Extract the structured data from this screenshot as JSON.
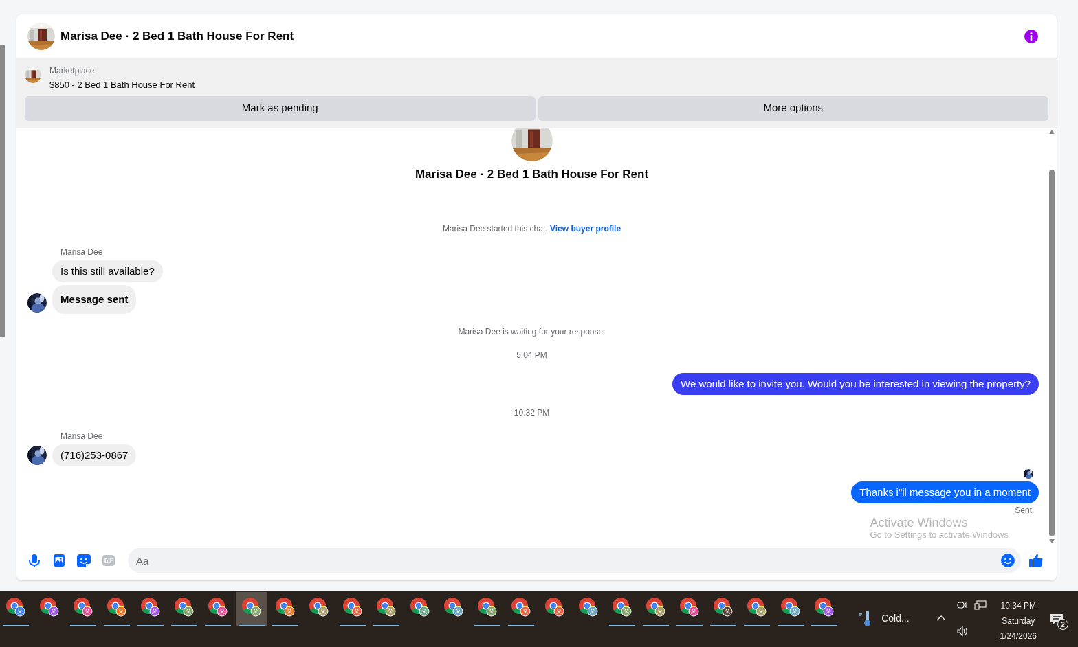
{
  "header": {
    "title": "Marisa Dee · 2 Bed 1 Bath House For Rent"
  },
  "listing": {
    "label": "Marketplace",
    "title": "$850 - 2 Bed 1 Bath House For Rent",
    "buttons": [
      "Mark as pending",
      "More options"
    ]
  },
  "conversation": {
    "title": "Marisa Dee · 2 Bed 1 Bath House For Rent",
    "items": [
      {
        "kind": "system",
        "text": "Marisa Dee started this chat.",
        "link": "View buyer profile"
      },
      {
        "kind": "incoming",
        "sender": "Marisa Dee",
        "messages": [
          {
            "text": "Is this still available?",
            "bold": false
          },
          {
            "text": "Message sent",
            "bold": true
          }
        ]
      },
      {
        "kind": "system",
        "text": "Marisa Dee is waiting for your response."
      },
      {
        "kind": "time",
        "text": "5:04 PM"
      },
      {
        "kind": "outgoing",
        "color": "#3a3ef2",
        "seen": false,
        "messages": [
          {
            "text": "We would like to invite you. Would you be interested in viewing the property?",
            "bold": false
          }
        ]
      },
      {
        "kind": "time",
        "text": "10:32 PM"
      },
      {
        "kind": "incoming",
        "sender": "Marisa Dee",
        "messages": [
          {
            "text": "(716)253-0867",
            "bold": false
          }
        ]
      },
      {
        "kind": "outgoing",
        "color": "#0866ff",
        "seen": true,
        "status": "Sent",
        "messages": [
          {
            "text": "Thanks i\"il message you in a moment",
            "bold": false
          }
        ]
      }
    ]
  },
  "composer": {
    "placeholder": "Aa"
  },
  "watermark": {
    "title": "Activate Windows",
    "subtitle": "Go to Settings to activate Windows"
  },
  "taskbar": {
    "apps": [
      {
        "color": "#3b82f6",
        "running": true,
        "selected": false
      },
      {
        "color": "#a855f7",
        "running": false,
        "selected": false
      },
      {
        "color": "#ec4899",
        "running": true,
        "selected": false
      },
      {
        "color": "#f97316",
        "running": true,
        "selected": false
      },
      {
        "color": "#a855f7",
        "running": true,
        "selected": false
      },
      {
        "color": "#84a86a",
        "running": true,
        "selected": false
      },
      {
        "color": "#ec4899",
        "running": true,
        "selected": false
      },
      {
        "color": "#84a86a",
        "running": true,
        "selected": true
      },
      {
        "color": "#f08030",
        "running": true,
        "selected": false
      },
      {
        "color": "#b0a070",
        "running": false,
        "selected": false
      },
      {
        "color": "#f06040",
        "running": true,
        "selected": false
      },
      {
        "color": "#a8a060",
        "running": true,
        "selected": false
      },
      {
        "color": "#6aa88a",
        "running": false,
        "selected": false
      },
      {
        "color": "#6aaac8",
        "running": false,
        "selected": false
      },
      {
        "color": "#84a86a",
        "running": true,
        "selected": false
      },
      {
        "color": "#f06040",
        "running": true,
        "selected": false
      },
      {
        "color": "#f06040",
        "running": false,
        "selected": false
      },
      {
        "color": "#6aaac8",
        "running": false,
        "selected": false
      },
      {
        "color": "#84a86a",
        "running": true,
        "selected": false
      },
      {
        "color": "#a8a060",
        "running": true,
        "selected": false
      },
      {
        "color": "#ec4899",
        "running": true,
        "selected": false
      },
      {
        "color": "#5a4636",
        "running": true,
        "selected": false
      },
      {
        "color": "#a8a060",
        "running": true,
        "selected": false
      },
      {
        "color": "#6aaac8",
        "running": true,
        "selected": false
      },
      {
        "color": "#a855f7",
        "running": true,
        "selected": false
      }
    ],
    "weather": "Cold...",
    "time": "10:34 PM",
    "day": "Saturday",
    "date": "1/24/2026",
    "notifications": "2"
  }
}
